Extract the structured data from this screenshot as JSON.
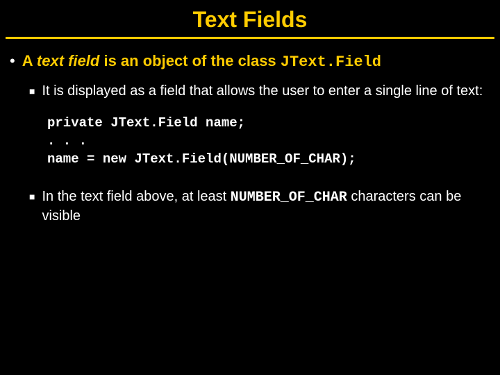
{
  "title": "Text Fields",
  "bullet1": {
    "prefix": "A ",
    "em": "text field",
    "mid": " is an object of the class ",
    "code": "JText.Field"
  },
  "sub1": {
    "text": "It is displayed as a field that allows the user to enter a single line of text:"
  },
  "code": {
    "line1": "private JText.Field name;",
    "line2": ". . .",
    "line3": "name = new JText.Field(NUMBER_OF_CHAR);"
  },
  "sub2": {
    "prefix": "In the text field above, at least ",
    "code": "NUMBER_OF_CHAR",
    "suffix": " characters can be visible"
  }
}
